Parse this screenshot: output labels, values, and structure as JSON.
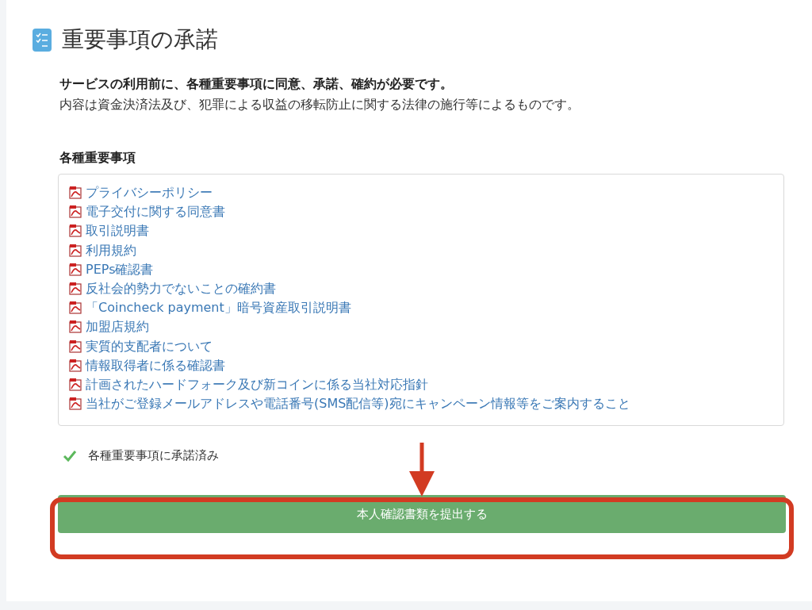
{
  "title": "重要事項の承諾",
  "intro": {
    "heading": "サービスの利用前に、各種重要事項に同意、承諾、確約が必要です。",
    "text": "内容は資金決済法及び、犯罪による収益の移転防止に関する法律の施行等によるものです。"
  },
  "documents": {
    "label": "各種重要事項",
    "items": [
      "プライバシーポリシー",
      "電子交付に関する同意書",
      "取引説明書",
      "利用規約",
      "PEPs確認書",
      "反社会的勢力でないことの確約書",
      "「Coincheck payment」暗号資産取引説明書",
      "加盟店規約",
      "実質的支配者について",
      "情報取得者に係る確認書",
      "計画されたハードフォーク及び新コインに係る当社対応指針",
      "当社がご登録メールアドレスや電話番号(SMS配信等)宛にキャンペーン情報等をご案内すること"
    ]
  },
  "acknowledgement": {
    "text": "各種重要事項に承諾済み",
    "checked": true
  },
  "submit_button": "本人確認書類を提出する"
}
